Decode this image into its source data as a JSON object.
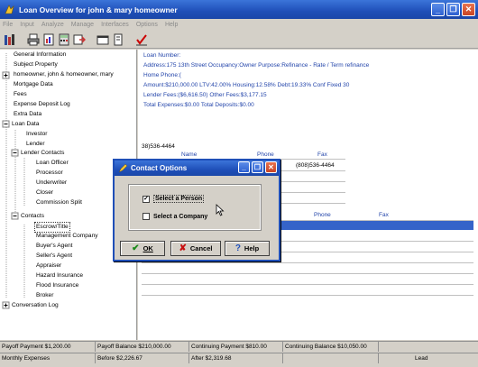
{
  "window": {
    "title": "Loan Overview for john & mary homeowner"
  },
  "menu": [
    "File",
    "Input",
    "Analyze",
    "Manage",
    "Interfaces",
    "Options",
    "Help"
  ],
  "tree": {
    "items": [
      "General Information",
      "Subject Property",
      "homeowner, john & homeowner, mary",
      "Mortgage Data",
      "Fees",
      "Expense Deposit Log",
      "Extra Data",
      "Loan Data",
      "Investor",
      "Lender",
      "Lender Contacts",
      "Loan Officer",
      "Processor",
      "Underwriter",
      "Closer",
      "Commission Split",
      "Contacts",
      "Escrow/Title",
      "Management Company",
      "Buyer's Agent",
      "Seller's Agent",
      "Appraiser",
      "Hazard Insurance",
      "Flood Insurance",
      "Broker",
      "Conversation Log"
    ]
  },
  "info": {
    "loan_number": "Loan Number:",
    "line2": "Address:175 13th Street   Occupancy:Owner   Purpose:Refinance - Rate / Term refinance",
    "line3": "Home Phone:(",
    "line4": "Amount:$210,000.00   LTV:42.00%   Housing:12.58%   Debt:19.33%   Conf Fixed 30",
    "line5": "Lender Fees:($6,616.50)   Other Fees:$3,177.15",
    "line6": "Total Expenses:$0.00   Total Deposits:$0.00"
  },
  "lender_table": {
    "phone_fragment": "38)536-4464",
    "headers": [
      "Name",
      "Phone",
      "Fax"
    ],
    "row_fax": "(808)536-4464"
  },
  "contacts_table": {
    "headers": [
      "Phone",
      "Fax"
    ]
  },
  "status": {
    "row1": [
      "Payoff Payment $1,200.00",
      "Payoff Balance $210,000.00",
      "Continuing Payment $810.00",
      "Continuing Balance $10,050.00",
      ""
    ],
    "row2": [
      "Monthly Expenses",
      "Before $2,226.67",
      "After $2,319.68",
      "",
      "Lead"
    ]
  },
  "dialog": {
    "title": "Contact Options",
    "option_person": "Select a Person",
    "option_company": "Select a Company",
    "ok_label": "OK",
    "cancel_label": "Cancel",
    "help_label": "Help",
    "person_checked": true,
    "company_checked": false
  },
  "colors": {
    "titlebar": "#1f4fb8",
    "selection": "#3563c9",
    "info_text": "#2244aa"
  }
}
